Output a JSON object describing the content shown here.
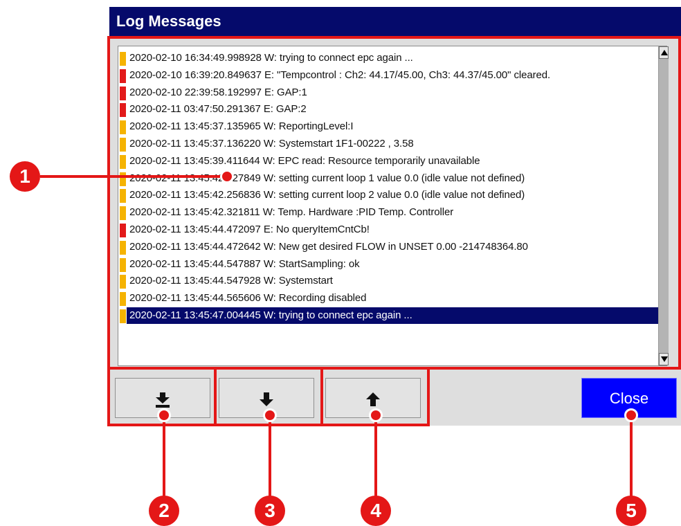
{
  "dialog": {
    "title": "Log Messages",
    "close_label": "Close",
    "accent_color": "#050a6b",
    "warning_color": "#f5b301",
    "error_color": "#e21a1a"
  },
  "log": [
    {
      "level": "W",
      "text": "2020-02-10 16:34:49.998928 W: trying to connect epc again ..."
    },
    {
      "level": "E",
      "text": "2020-02-10 16:39:20.849637 E: \"Tempcontrol : Ch2: 44.17/45.00, Ch3: 44.37/45.00\" cleared."
    },
    {
      "level": "E",
      "text": "2020-02-10 22:39:58.192997 E: GAP:1"
    },
    {
      "level": "E",
      "text": "2020-02-11 03:47:50.291367 E: GAP:2"
    },
    {
      "level": "W",
      "text": "2020-02-11 13:45:37.135965 W: ReportingLevel:I"
    },
    {
      "level": "W",
      "text": "2020-02-11 13:45:37.136220 W: Systemstart 1F1-00222 ,  3.58"
    },
    {
      "level": "W",
      "text": "2020-02-11 13:45:39.411644 W: EPC read: Resource temporarily unavailable"
    },
    {
      "level": "W",
      "text": "2020-02-11 13:45:42.227849 W: setting current loop 1  value 0.0 (idle value not defined)"
    },
    {
      "level": "W",
      "text": "2020-02-11 13:45:42.256836 W: setting current loop 2  value 0.0 (idle value not defined)"
    },
    {
      "level": "W",
      "text": "2020-02-11 13:45:42.321811 W: Temp. Hardware :PID Temp. Controller"
    },
    {
      "level": "E",
      "text": "2020-02-11 13:45:44.472097 E: No queryItemCntCb!"
    },
    {
      "level": "W",
      "text": "2020-02-11 13:45:44.472642 W: New get desired FLOW in UNSET 0.00 -214748364.80"
    },
    {
      "level": "W",
      "text": "2020-02-11 13:45:44.547887 W: StartSampling: ok"
    },
    {
      "level": "W",
      "text": "2020-02-11 13:45:44.547928 W: Systemstart"
    },
    {
      "level": "W",
      "text": "2020-02-11 13:45:44.565606 W: Recording disabled"
    },
    {
      "level": "W",
      "text": "2020-02-11 13:45:47.004445 W: trying to connect epc again ...",
      "selected": true
    }
  ],
  "buttons": {
    "scroll_bottom_icon": "arrow-down-to-bar-icon",
    "scroll_down_icon": "arrow-down-icon",
    "scroll_up_icon": "arrow-up-icon"
  },
  "callouts": [
    "1",
    "2",
    "3",
    "4",
    "5"
  ]
}
